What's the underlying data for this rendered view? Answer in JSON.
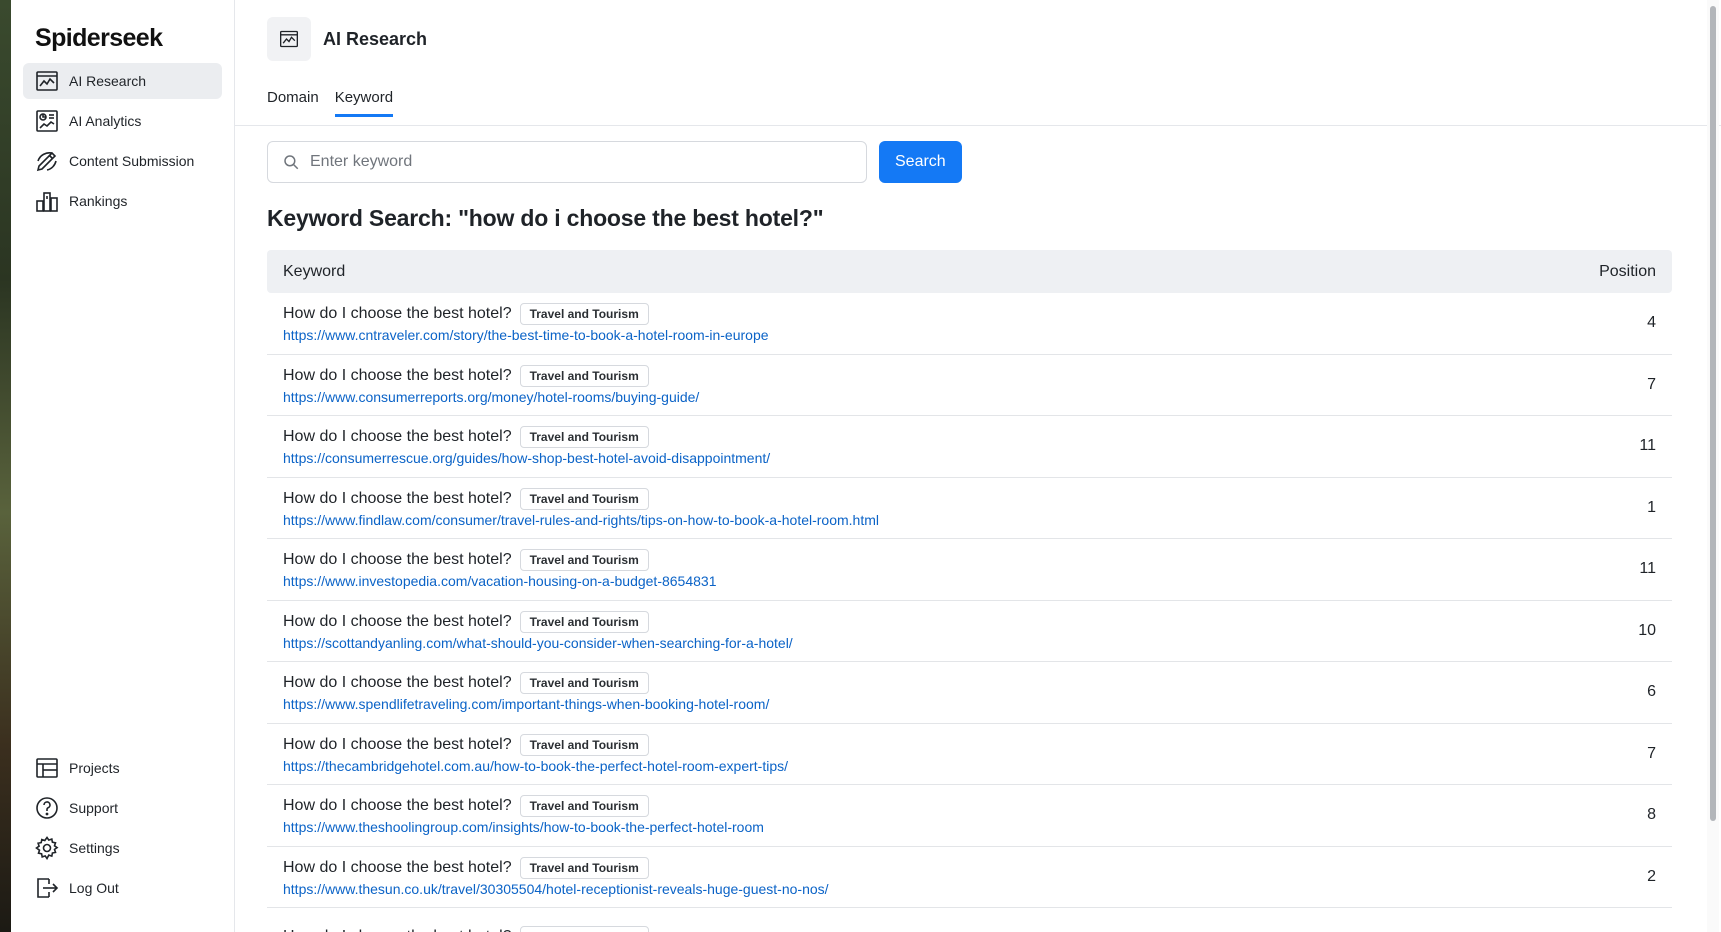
{
  "brand": "Spiderseek",
  "nav": {
    "items": [
      {
        "label": "AI Research",
        "icon": "chart-window-icon",
        "active": true
      },
      {
        "label": "AI Analytics",
        "icon": "analytics-report-icon",
        "active": false
      },
      {
        "label": "Content Submission",
        "icon": "submission-icon",
        "active": false
      },
      {
        "label": "Rankings",
        "icon": "rankings-icon",
        "active": false
      }
    ],
    "bottom": [
      {
        "label": "Projects",
        "icon": "table-icon"
      },
      {
        "label": "Support",
        "icon": "help-circle-icon"
      },
      {
        "label": "Settings",
        "icon": "gear-icon"
      },
      {
        "label": "Log Out",
        "icon": "logout-icon"
      }
    ]
  },
  "header": {
    "title": "AI Research",
    "tabs": [
      {
        "label": "Domain",
        "active": false
      },
      {
        "label": "Keyword",
        "active": true
      }
    ]
  },
  "search": {
    "placeholder": "Enter keyword",
    "value": "",
    "button_label": "Search"
  },
  "result_heading": "Keyword Search: \"how do i choose the best hotel?\"",
  "table": {
    "columns": [
      "Keyword",
      "Position"
    ],
    "rows": [
      {
        "keyword": "How do I choose the best hotel?",
        "category": "Travel and Tourism",
        "url": "https://www.cntraveler.com/story/the-best-time-to-book-a-hotel-room-in-europe",
        "position": "4"
      },
      {
        "keyword": "How do I choose the best hotel?",
        "category": "Travel and Tourism",
        "url": "https://www.consumerreports.org/money/hotel-rooms/buying-guide/",
        "position": "7"
      },
      {
        "keyword": "How do I choose the best hotel?",
        "category": "Travel and Tourism",
        "url": "https://consumerrescue.org/guides/how-shop-best-hotel-avoid-disappointment/",
        "position": "11"
      },
      {
        "keyword": "How do I choose the best hotel?",
        "category": "Travel and Tourism",
        "url": "https://www.findlaw.com/consumer/travel-rules-and-rights/tips-on-how-to-book-a-hotel-room.html",
        "position": "1"
      },
      {
        "keyword": "How do I choose the best hotel?",
        "category": "Travel and Tourism",
        "url": "https://www.investopedia.com/vacation-housing-on-a-budget-8654831",
        "position": "11"
      },
      {
        "keyword": "How do I choose the best hotel?",
        "category": "Travel and Tourism",
        "url": "https://scottandyanling.com/what-should-you-consider-when-searching-for-a-hotel/",
        "position": "10"
      },
      {
        "keyword": "How do I choose the best hotel?",
        "category": "Travel and Tourism",
        "url": "https://www.spendlifetraveling.com/important-things-when-booking-hotel-room/",
        "position": "6"
      },
      {
        "keyword": "How do I choose the best hotel?",
        "category": "Travel and Tourism",
        "url": "https://thecambridgehotel.com.au/how-to-book-the-perfect-hotel-room-expert-tips/",
        "position": "7"
      },
      {
        "keyword": "How do I choose the best hotel?",
        "category": "Travel and Tourism",
        "url": "https://www.theshoolingroup.com/insights/how-to-book-the-perfect-hotel-room",
        "position": "8"
      },
      {
        "keyword": "How do I choose the best hotel?",
        "category": "Travel and Tourism",
        "url": "https://www.thesun.co.uk/travel/30305504/hotel-receptionist-reveals-huge-guest-no-nos/",
        "position": "2"
      },
      {
        "keyword": "How do I choose the best hotel?",
        "category": "Travel and Tourism",
        "url": "",
        "position": ""
      }
    ]
  },
  "colors": {
    "accent": "#1479f5",
    "link": "#0b63c7",
    "active_nav_bg": "#ebedf0",
    "table_header_bg": "#eef0f3"
  }
}
